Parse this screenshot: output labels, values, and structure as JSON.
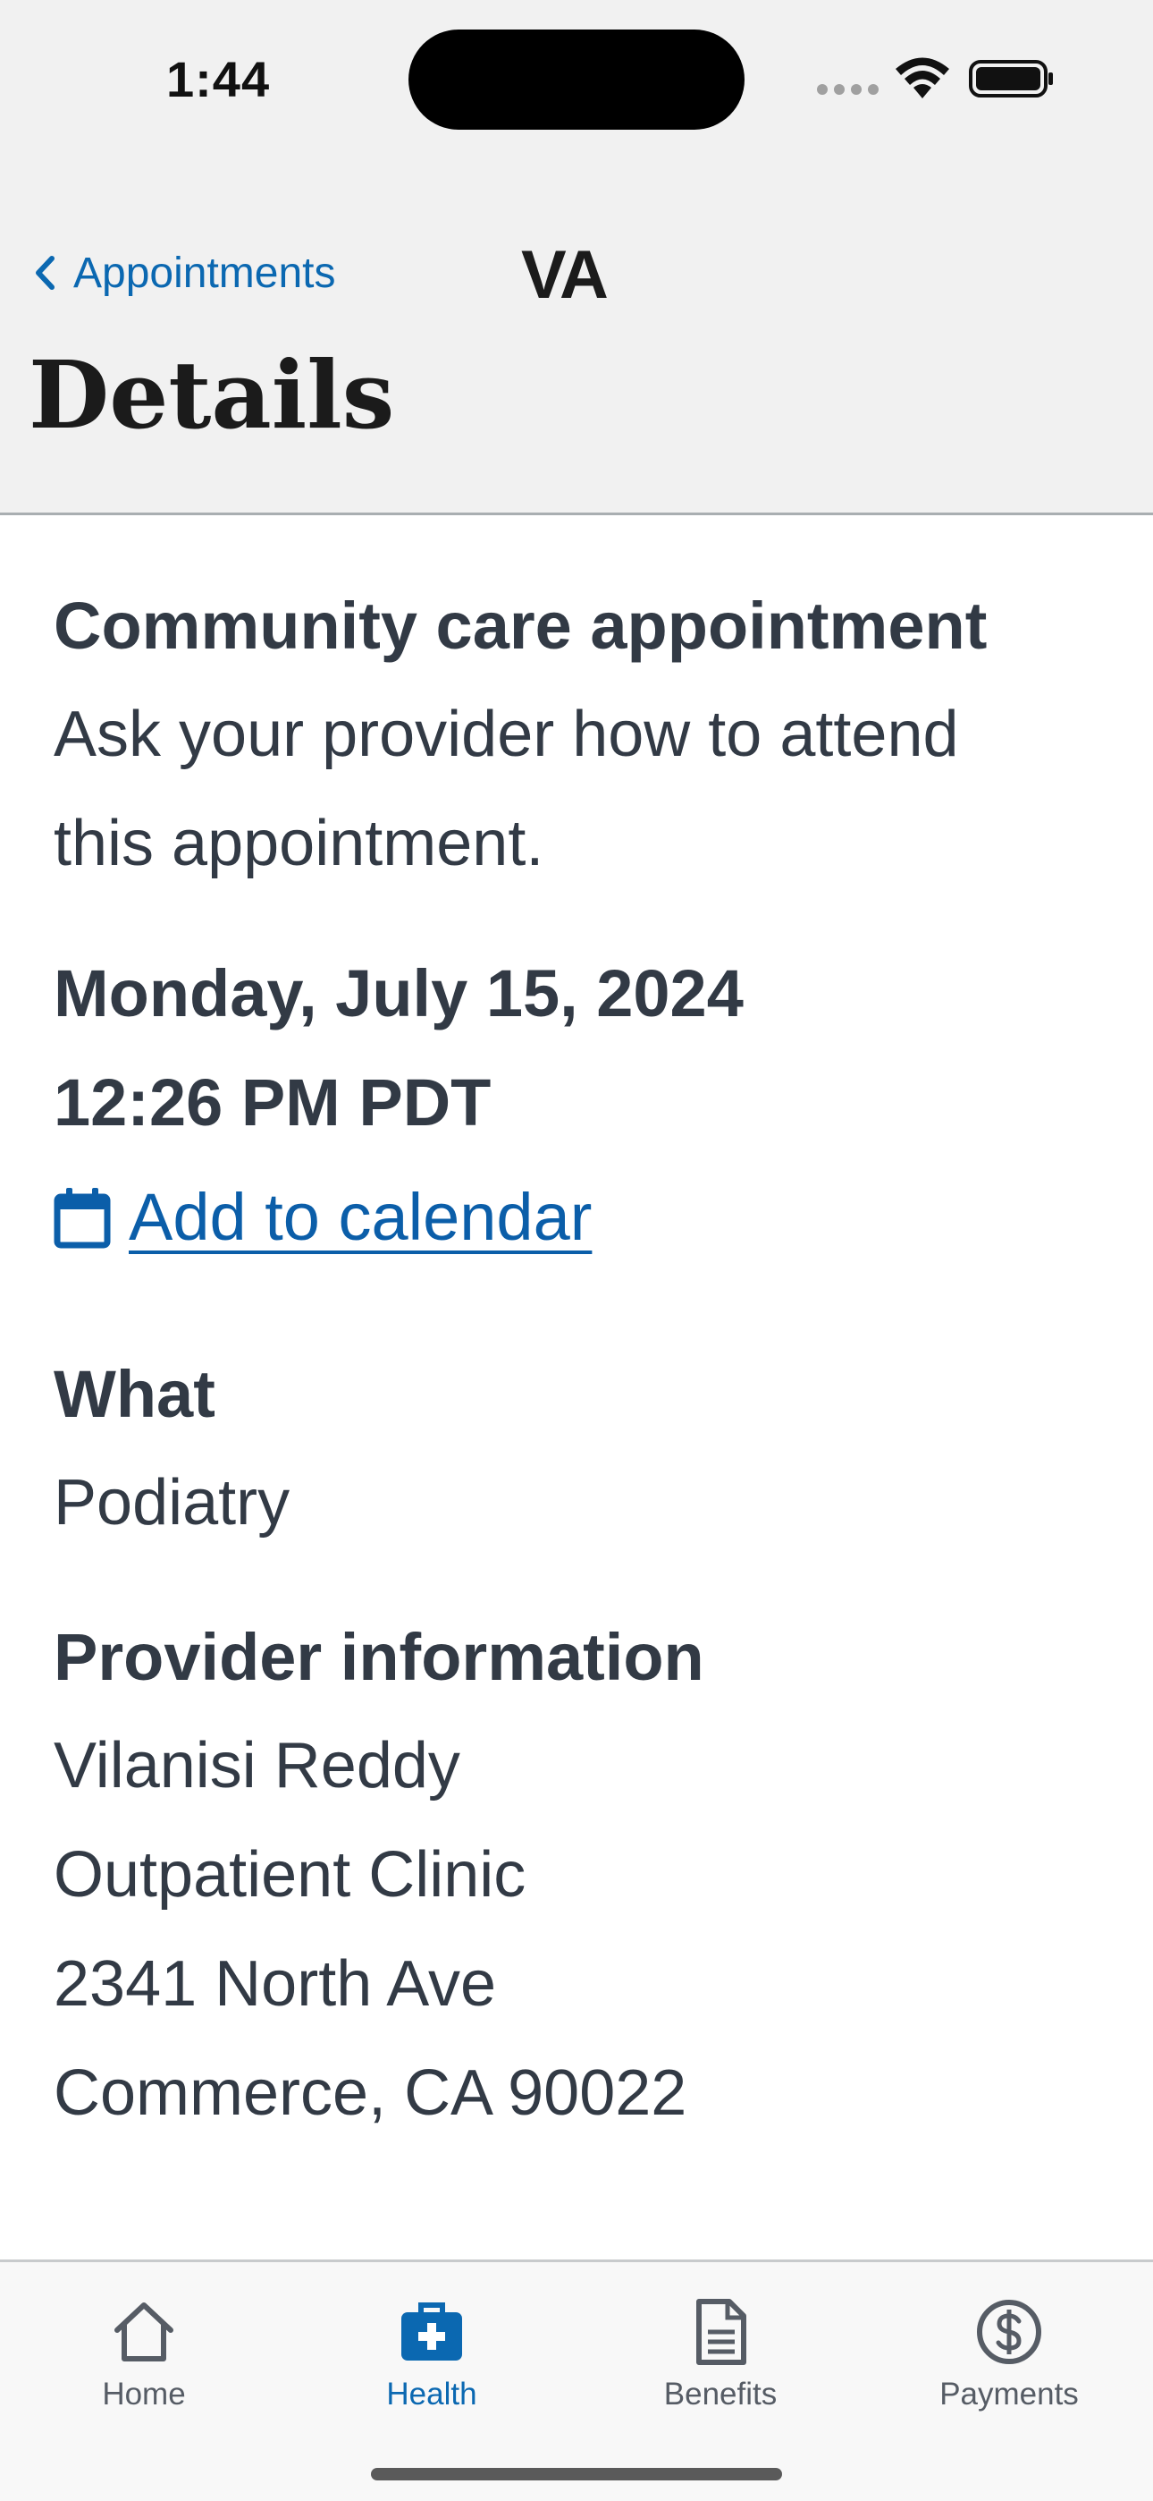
{
  "status_bar": {
    "time": "1:44"
  },
  "nav": {
    "back_label": "Appointments",
    "logo": "VA",
    "page_title": "Details"
  },
  "appointment": {
    "type_title": "Community care appointment",
    "instruction_lines": [
      "Ask your provider how to attend",
      "this appointment."
    ],
    "date": "Monday, July 15, 2024",
    "time": "12:26 PM PDT",
    "add_to_calendar_label": "Add to calendar",
    "what": {
      "label": "What",
      "value": "Podiatry"
    },
    "provider": {
      "label": "Provider information",
      "lines": [
        "Vilanisi Reddy",
        "Outpatient Clinic",
        "2341 North Ave",
        "Commerce, CA 90022"
      ]
    }
  },
  "tab_bar": {
    "tabs": [
      {
        "label": "Home",
        "icon": "house-icon",
        "active": false
      },
      {
        "label": "Health",
        "icon": "medical-briefcase-icon",
        "active": true
      },
      {
        "label": "Benefits",
        "icon": "document-icon",
        "active": false
      },
      {
        "label": "Payments",
        "icon": "dollar-circle-icon",
        "active": false
      }
    ]
  },
  "colors": {
    "accent": "#0b68b1",
    "link": "#0b5ea9",
    "text": "#323a45",
    "header_bg": "#f1f1f1",
    "tab_bg": "#f8f8f8"
  }
}
